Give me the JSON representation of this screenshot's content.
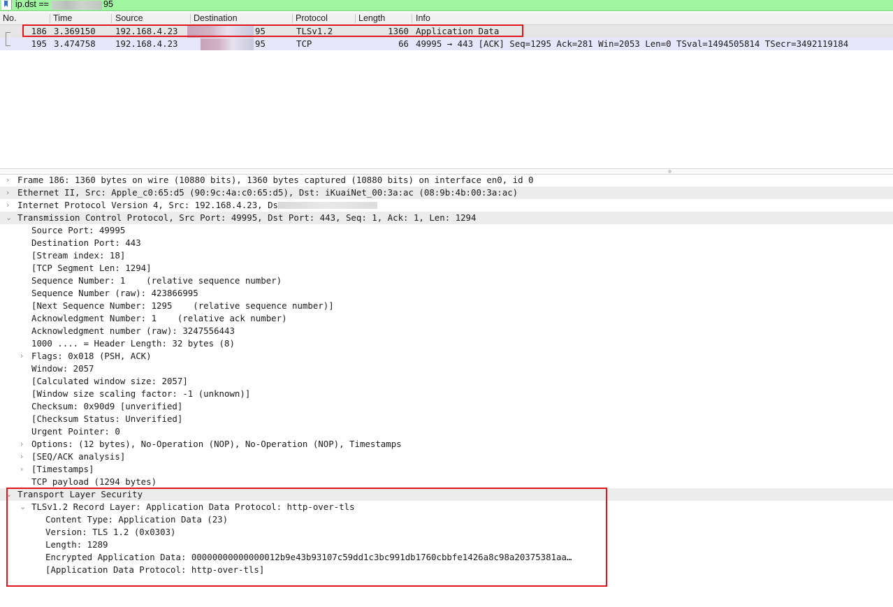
{
  "filter": {
    "prefix": "ip.dst ==",
    "suffix": "95"
  },
  "columns": {
    "no": "No.",
    "time": "Time",
    "source": "Source",
    "destination": "Destination",
    "protocol": "Protocol",
    "length": "Length",
    "info": "Info"
  },
  "packets": [
    {
      "no": "186",
      "time": "3.369150",
      "source": "192.168.4.23",
      "destination_tail": "95",
      "protocol": "TLSv1.2",
      "length": "1360",
      "info": "Application Data"
    },
    {
      "no": "195",
      "time": "3.474758",
      "source": "192.168.4.23",
      "destination_tail": "95",
      "protocol": "TCP",
      "length": "66",
      "info": "49995 → 443 [ACK] Seq=1295 Ack=281 Win=2053 Len=0 TSval=1494505814 TSecr=3492119184"
    }
  ],
  "details": {
    "frame": "Frame 186: 1360 bytes on wire (10880 bits), 1360 bytes captured (10880 bits) on interface en0, id 0",
    "ethernet": "Ethernet II, Src: Apple_c0:65:d5 (90:9c:4a:c0:65:d5), Dst: iKuaiNet_00:3a:ac (08:9b:4b:00:3a:ac)",
    "ip": "Internet Protocol Version 4, Src: 192.168.4.23, Dst:",
    "tcp": "Transmission Control Protocol, Src Port: 49995, Dst Port: 443, Seq: 1, Ack: 1, Len: 1294",
    "tcp_fields": [
      "Source Port: 49995",
      "Destination Port: 443",
      "[Stream index: 18]",
      "[TCP Segment Len: 1294]",
      "Sequence Number: 1    (relative sequence number)",
      "Sequence Number (raw): 423866995",
      "[Next Sequence Number: 1295    (relative sequence number)]",
      "Acknowledgment Number: 1    (relative ack number)",
      "Acknowledgment number (raw): 3247556443",
      "1000 .... = Header Length: 32 bytes (8)",
      "Flags: 0x018 (PSH, ACK)",
      "Window: 2057",
      "[Calculated window size: 2057]",
      "[Window size scaling factor: -1 (unknown)]",
      "Checksum: 0x90d9 [unverified]",
      "[Checksum Status: Unverified]",
      "Urgent Pointer: 0",
      "Options: (12 bytes), No-Operation (NOP), No-Operation (NOP), Timestamps",
      "[SEQ/ACK analysis]",
      "[Timestamps]",
      "TCP payload (1294 bytes)"
    ],
    "tls": "Transport Layer Security",
    "tls_record": "TLSv1.2 Record Layer: Application Data Protocol: http-over-tls",
    "tls_fields": [
      "Content Type: Application Data (23)",
      "Version: TLS 1.2 (0x0303)",
      "Length: 1289",
      "Encrypted Application Data: 00000000000000012b9e43b93107c59dd1c3bc991db1760cbbfe1426a8c98a20375381aa…",
      "[Application Data Protocol: http-over-tls]"
    ]
  },
  "icons": {
    "collapsed": "›",
    "expanded": "⌄"
  },
  "colors": {
    "filter_bg": "#a0f5a0",
    "selected_row": "#e6e6e6",
    "tcp_row": "#e7e6fb",
    "highlight": "#e0161c"
  }
}
